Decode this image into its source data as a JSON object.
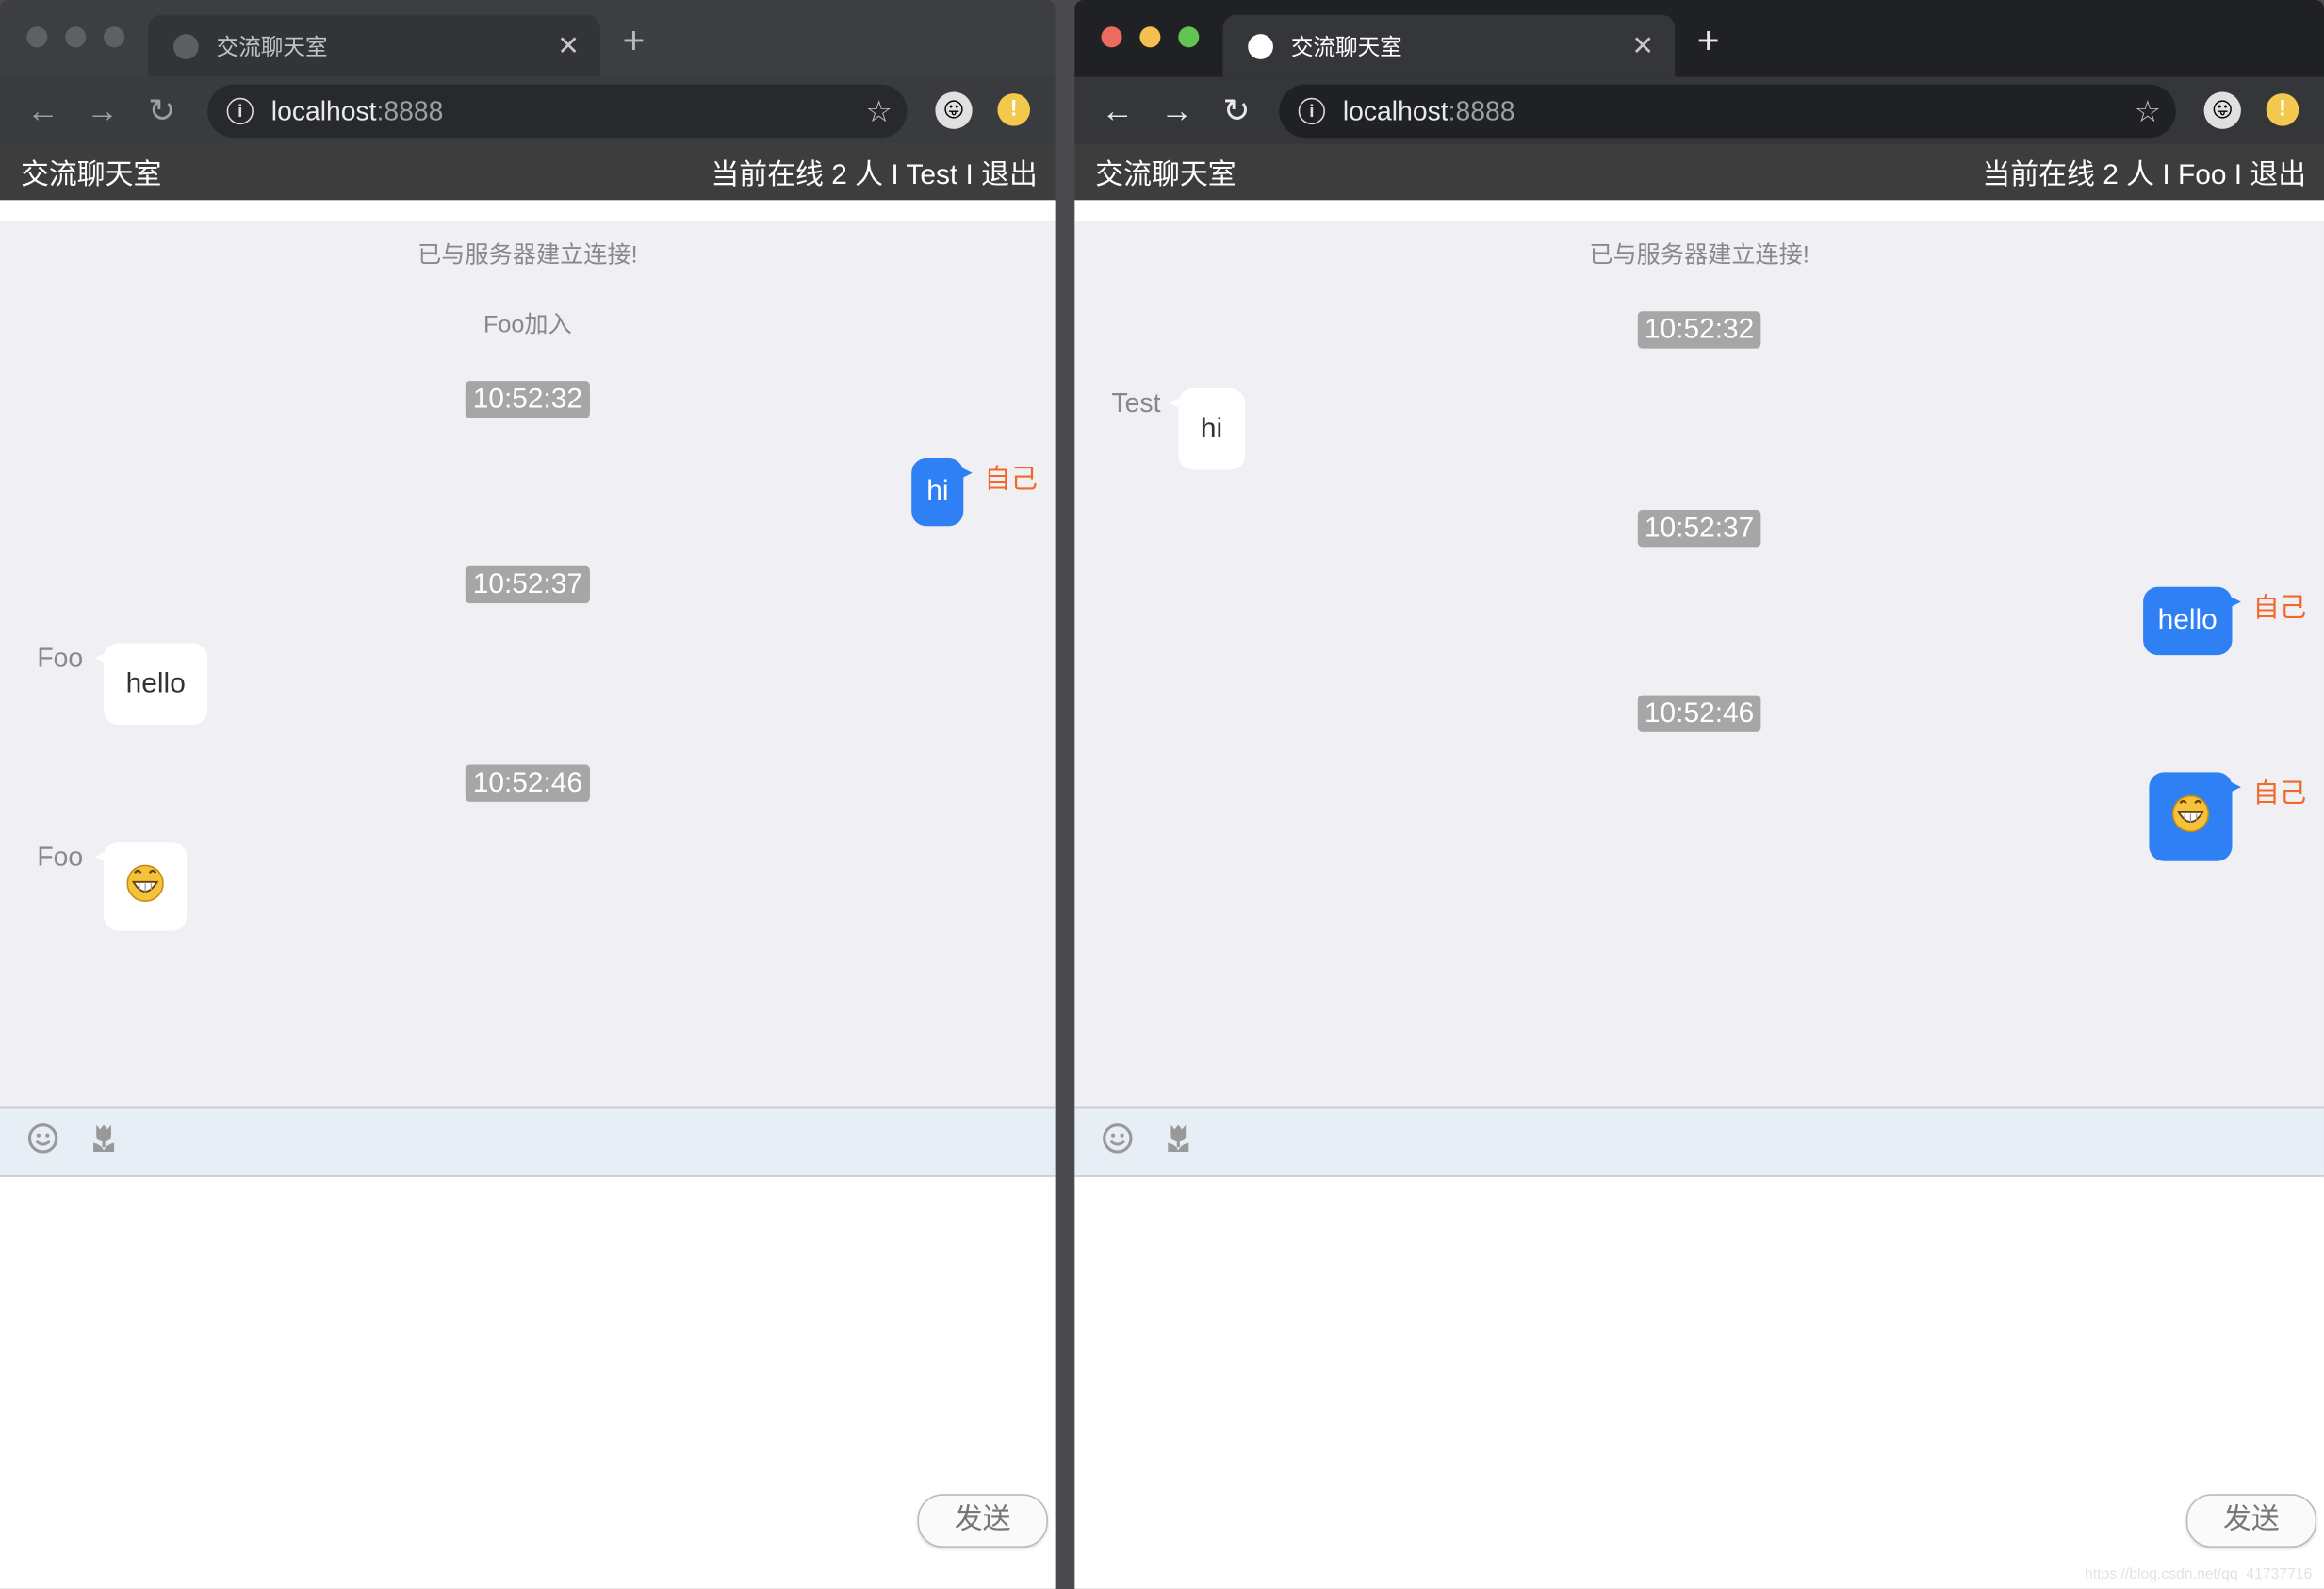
{
  "colors": {
    "self_bubble": "#2f7ff5",
    "self_label": "#f0692a",
    "timestamp_bg": "#a6a6a6",
    "chat_bg": "#f0eff4",
    "header_bg": "#3d3d3d",
    "traffic_red": "#ed6a5e",
    "traffic_yellow": "#f5bf4f",
    "traffic_green": "#61c554"
  },
  "windows": [
    {
      "id": "left",
      "tab_title": "交流聊天室",
      "url_host": "localhost",
      "url_port": ":8888",
      "app_title": "交流聊天室",
      "status": "当前在线 2 人 I Test I 退出",
      "send_label": "发送",
      "messages": [
        {
          "type": "system",
          "text": "已与服务器建立连接!"
        },
        {
          "type": "system",
          "text": "Foo加入"
        },
        {
          "type": "time",
          "text": "10:52:32"
        },
        {
          "type": "self",
          "text": "hi",
          "who": "自己"
        },
        {
          "type": "time",
          "text": "10:52:37"
        },
        {
          "type": "other",
          "text": "hello",
          "who": "Foo"
        },
        {
          "type": "time",
          "text": "10:52:46"
        },
        {
          "type": "other",
          "emoji": "grinning-face",
          "who": "Foo"
        }
      ]
    },
    {
      "id": "right",
      "tab_title": "交流聊天室",
      "url_host": "localhost",
      "url_port": ":8888",
      "app_title": "交流聊天室",
      "status": "当前在线 2 人 I Foo I 退出",
      "send_label": "发送",
      "watermark": "https://blog.csdn.net/qq_41737716",
      "messages": [
        {
          "type": "system",
          "text": "已与服务器建立连接!"
        },
        {
          "type": "time",
          "text": "10:52:32"
        },
        {
          "type": "other",
          "text": "hi",
          "who": "Test"
        },
        {
          "type": "time",
          "text": "10:52:37"
        },
        {
          "type": "self",
          "text": "hello",
          "who": "自己"
        },
        {
          "type": "time",
          "text": "10:52:46"
        },
        {
          "type": "self",
          "emoji": "grinning-face",
          "who": "自己"
        }
      ]
    }
  ]
}
